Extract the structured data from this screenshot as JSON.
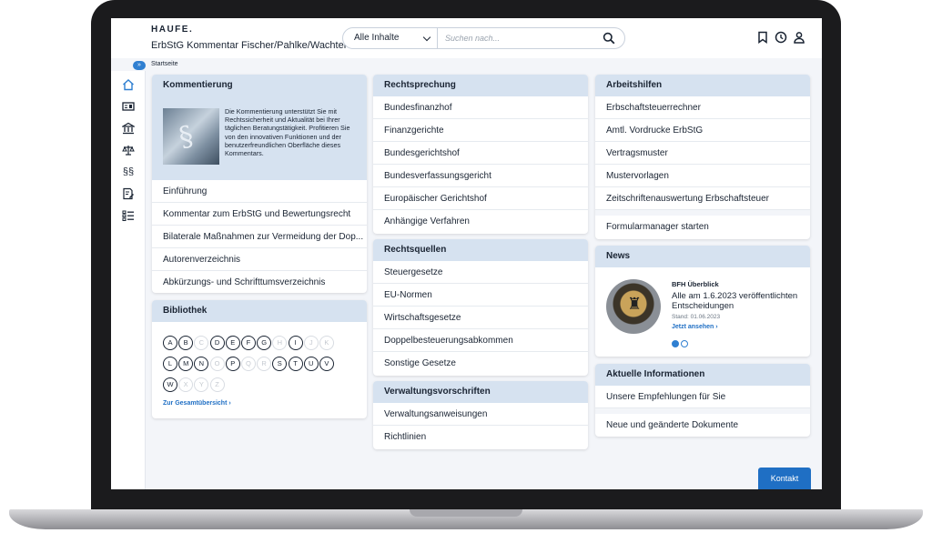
{
  "header": {
    "logo": "HAUFE.",
    "title": "ErbStG Kommentar Fischer/Pahlke/Wachter",
    "search_scope": "Alle Inhalte",
    "search_placeholder": "Suchen nach..."
  },
  "breadcrumb": {
    "toggle": "»",
    "current": "Startseite"
  },
  "kommentierung": {
    "title": "Kommentierung",
    "intro": "Die Kommentierung unterstützt Sie mit Rechtssicherheit und Aktualität bei Ihrer täglichen Beratungstätigkeit. Profitieren Sie von den innovativen Funktionen und der benutzerfreundlichen Oberfläche dieses Kommentars.",
    "items": [
      "Einführung",
      "Kommentar zum ErbStG und Bewertungsrecht",
      "Bilaterale Maßnahmen zur Vermeidung der Dop...",
      "Autorenverzeichnis",
      "Abkürzungs- und Schrifttumsverzeichnis"
    ]
  },
  "bibliothek": {
    "title": "Bibliothek",
    "letters": [
      {
        "l": "A",
        "on": true
      },
      {
        "l": "B",
        "on": true
      },
      {
        "l": "C",
        "on": false
      },
      {
        "l": "D",
        "on": true
      },
      {
        "l": "E",
        "on": true
      },
      {
        "l": "F",
        "on": true
      },
      {
        "l": "G",
        "on": true
      },
      {
        "l": "H",
        "on": false
      },
      {
        "l": "I",
        "on": true
      },
      {
        "l": "J",
        "on": false
      },
      {
        "l": "K",
        "on": false
      },
      {
        "l": "L",
        "on": true
      },
      {
        "l": "M",
        "on": true
      },
      {
        "l": "N",
        "on": true
      },
      {
        "l": "O",
        "on": false
      },
      {
        "l": "P",
        "on": true
      },
      {
        "l": "Q",
        "on": false
      },
      {
        "l": "R",
        "on": false
      },
      {
        "l": "S",
        "on": true
      },
      {
        "l": "T",
        "on": true
      },
      {
        "l": "U",
        "on": true
      },
      {
        "l": "V",
        "on": true
      },
      {
        "l": "W",
        "on": true
      },
      {
        "l": "X",
        "on": false
      },
      {
        "l": "Y",
        "on": false
      },
      {
        "l": "Z",
        "on": false
      }
    ],
    "link": "Zur Gesamtübersicht ›"
  },
  "rechtsprechung": {
    "title": "Rechtsprechung",
    "items": [
      "Bundesfinanzhof",
      "Finanzgerichte",
      "Bundesgerichtshof",
      "Bundesverfassungsgericht",
      "Europäischer Gerichtshof",
      "Anhängige Verfahren"
    ]
  },
  "rechtsquellen": {
    "title": "Rechtsquellen",
    "items": [
      "Steuergesetze",
      "EU-Normen",
      "Wirtschaftsgesetze",
      "Doppelbesteuerungsabkommen",
      "Sonstige Gesetze"
    ]
  },
  "verwaltung": {
    "title": "Verwaltungsvorschriften",
    "items": [
      "Verwaltungsanweisungen",
      "Richtlinien"
    ]
  },
  "arbeitshilfen": {
    "title": "Arbeitshilfen",
    "items": [
      "Erbschaftsteuerrechner",
      "Amtl. Vordrucke ErbStG",
      "Vertragsmuster",
      "Mustervorlagen",
      "Zeitschriftenauswertung Erbschaftsteuer"
    ],
    "extra": "Formularmanager starten"
  },
  "news": {
    "title": "News",
    "label": "BFH Überblick",
    "headline": "Alle am 1.6.2023 veröffentlichten Entscheidungen",
    "date": "Stand: 01.06.2023",
    "link": "Jetzt ansehen ›",
    "active_slide": 1,
    "slide_count": 2
  },
  "aktuelle": {
    "title": "Aktuelle Informationen",
    "items": [
      "Unsere Empfehlungen für Sie",
      "Neue und geänderte Dokumente"
    ]
  },
  "contact_label": "Kontakt",
  "colors": {
    "accent": "#1f6fc4",
    "card_header": "#d6e2f0",
    "page_bg": "#f3f5f9"
  },
  "rail_icons": [
    "home-icon",
    "document-list-icon",
    "court-icon",
    "scales-icon",
    "paragraph-icon",
    "form-edit-icon",
    "checklist-icon"
  ]
}
